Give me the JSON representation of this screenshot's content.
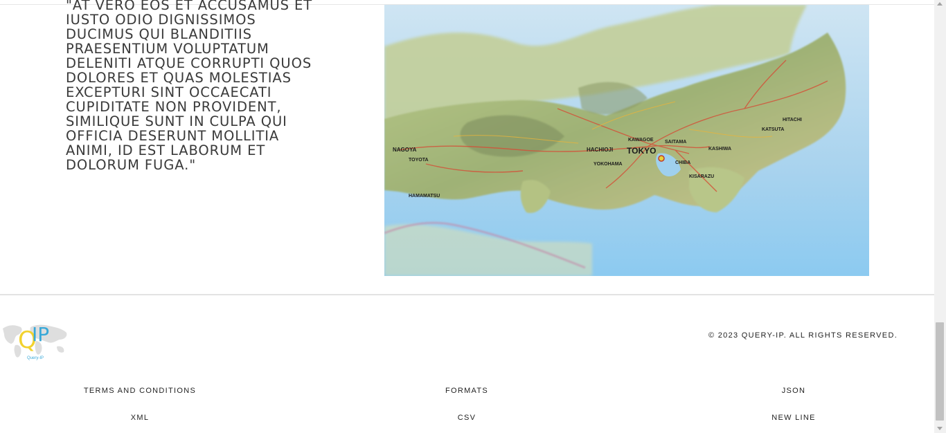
{
  "content": {
    "quote_text": "\"AT VERO EOS ET ACCUSAMUS ET IUSTO ODIO DIGNISSIMOS DUCIMUS QUI BLANDITIIS PRAESENTIUM VOLUPTATUM DELENITI ATQUE CORRUPTI QUOS DOLORES ET QUAS MOLESTIAS EXCEPTURI SINT OCCAECATI CUPIDITATE NON PROVIDENT, SIMILIQUE SUNT IN CULPA QUI OFFICIA DESERUNT MOLLITIA ANIMI, ID EST LABORUM ET DOLORUM FUGA.\"",
    "map_labels": {
      "tokyo": "TOKYO",
      "hachioji": "HACHIOJI",
      "kawagoe": "KAWAGOE",
      "saitama": "SAITAMA",
      "kashiwa": "KASHIWA",
      "katsuta": "KATSUTA",
      "hitachi": "HITACHI",
      "nagoya": "NAGOYA",
      "toyota": "TOYOTA",
      "hamamatsu": "HAMAMATSU",
      "yokohama": "YOKOHAMA",
      "chiba": "CHIBA",
      "kisarazu": "KISARAZU"
    }
  },
  "footer": {
    "logo": {
      "mark": "QIP",
      "caption": "Query-IP"
    },
    "copyright": "© 2023 QUERY-IP. ALL RIGHTS RESERVED.",
    "links": {
      "terms": "TERMS AND CONDITIONS",
      "formats": "FORMATS",
      "json": "JSON",
      "xml": "XML",
      "csv": "CSV",
      "newline": "NEW LINE"
    }
  },
  "colors": {
    "logo_yellow": "#f2d22e",
    "logo_blue": "#38a8d8"
  }
}
